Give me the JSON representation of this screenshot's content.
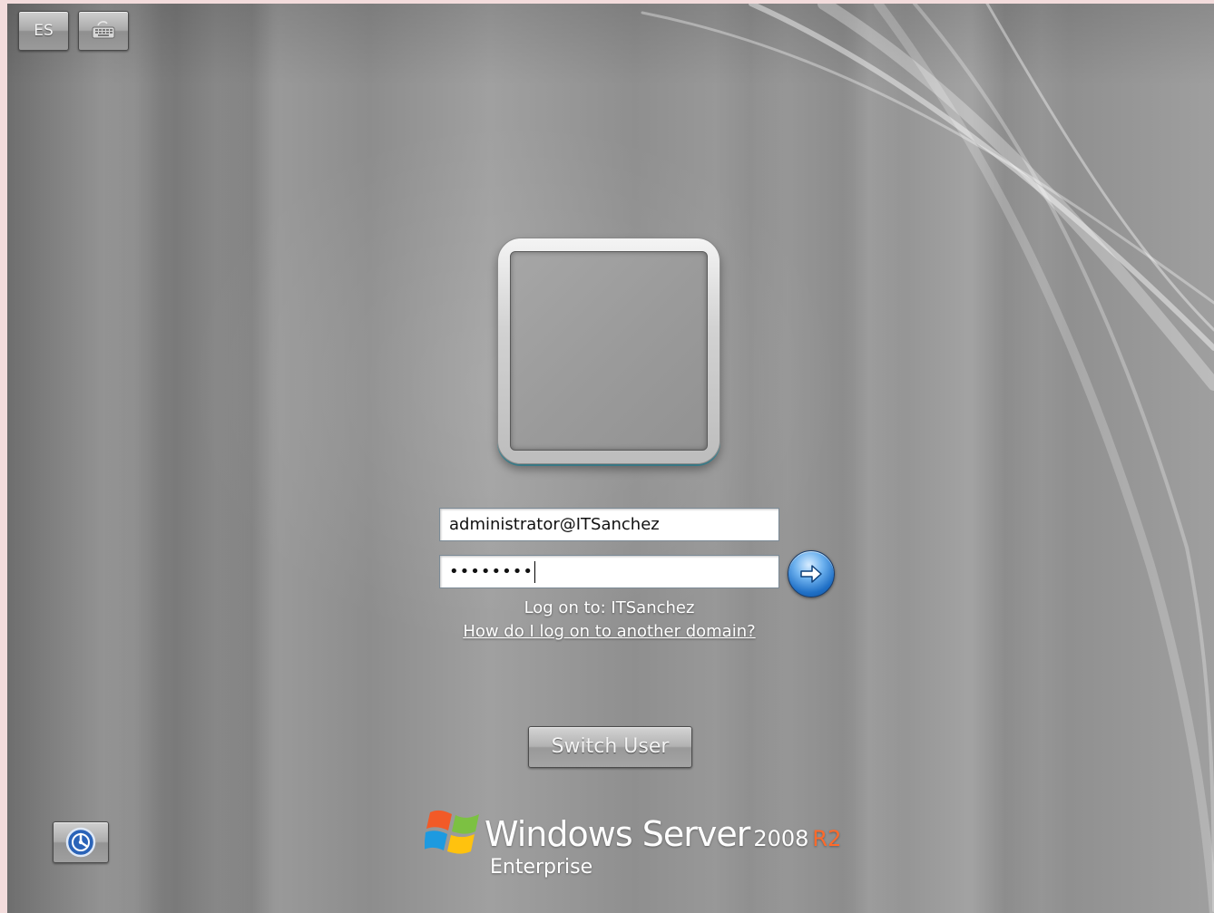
{
  "toolbar": {
    "language_label": "ES",
    "keyboard_icon": "keyboard-icon"
  },
  "login": {
    "username_value": "administrator@ITSanchez",
    "password_mask": "••••••••",
    "submit_icon": "arrow-right-icon",
    "logon_to": "Log on to: ITSanchez",
    "domain_help_link": "How do I log on to another domain?",
    "switch_user_label": "Switch User"
  },
  "ease_of_access_icon": "ease-of-access-icon",
  "branding": {
    "product": "Windows Server",
    "version": "2008",
    "release": "R2",
    "edition": "Enterprise",
    "logo_icon": "windows-flag-icon",
    "release_color": "#ff6a2a"
  }
}
